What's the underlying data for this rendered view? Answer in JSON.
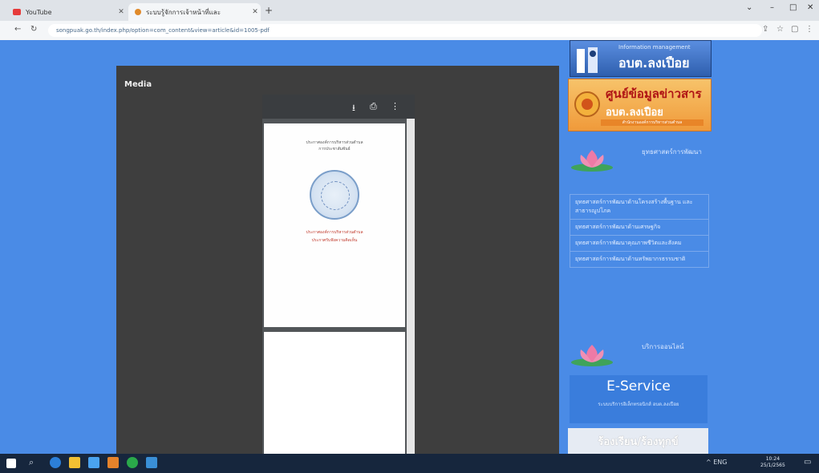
{
  "browser": {
    "tabs": [
      {
        "label": "YouTube",
        "active": false,
        "icon": "youtube-icon",
        "color": "#e63b3b"
      },
      {
        "label": "ระบบรู้จักการเจ้าหน้าที่และ",
        "active": true,
        "icon": "site-favicon",
        "color": "#e08a2a"
      }
    ],
    "url": "songpuak.go.th/index.php/option=com_content&view=article&id=1005-pdf",
    "window_controls": [
      "minimize",
      "maximize",
      "close"
    ]
  },
  "media_overlay": {
    "title": "Media",
    "viewer_toolbar": [
      "download-icon",
      "print-icon",
      "more-vert-icon"
    ],
    "page1": {
      "header_line1": "ประกาศองค์การบริหารส่วนตำบล",
      "header_line2": "การประชาสัมพันธ์",
      "red_line1": "ประกาศองค์การบริหารส่วนตำบล",
      "red_line2": "ประกาศรับฟังความคิดเห็น"
    }
  },
  "sidebar": {
    "banner1": {
      "sub": "Information management",
      "main": "อบต.ลงเปือย"
    },
    "banner2": {
      "main": "ศูนย์ข้อมูลข่าวสาร",
      "sub": "อบต.ลงเปือย",
      "tag": "สำนักงานองค์การบริหารส่วนตำบล"
    },
    "section1_title": "ยุทธศาสตร์การพัฒนา",
    "list_items": [
      "ยุทธศาสตร์การพัฒนาด้านโครงสร้างพื้นฐาน และสาธารณูปโภค",
      "ยุทธศาสตร์การพัฒนาด้านเศรษฐกิจ",
      "ยุทธศาสตร์การพัฒนาคุณภาพชีวิตและสังคม",
      "ยุทธศาสตร์การพัฒนาด้านทรัพยากรธรรมชาติ"
    ],
    "section2_title": "บริการออนไลน์",
    "eservice": {
      "title": "E-Service",
      "subtitle": "ระบบบริการอิเล็กทรอนิกส์ อบต.ลงเปือย"
    },
    "bottom_button": "ร้องเรียน/ร้องทุกข์"
  },
  "taskbar": {
    "time": "10:24",
    "date": "25/1/2565",
    "tray": "^ ENG"
  }
}
